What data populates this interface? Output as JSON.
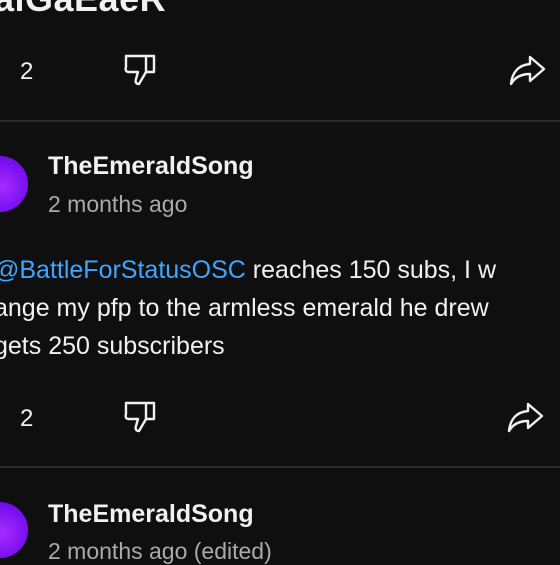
{
  "top_comment": {
    "text_fragment": "alGaEaeR",
    "likes": "2"
  },
  "comments": [
    {
      "username": "TheEmeraldSong",
      "timestamp": "2 months ago",
      "mention": "@BattleForStatusOSC",
      "text_line1_rest": " reaches 150 subs, I w",
      "text_line2": "ange my pfp to the armless emerald he drew",
      "text_line3": "gets 250 subscribers",
      "likes": "2"
    },
    {
      "username": "TheEmeraldSong",
      "timestamp": "2 months ago (edited)"
    }
  ],
  "colors": {
    "background": "#0f0f0f",
    "text": "#f1f1f1",
    "secondary_text": "#aaaaaa",
    "mention": "#3ea6ff",
    "avatar": "#7b10f2"
  },
  "icons": [
    "like-icon",
    "dislike-icon",
    "share-icon"
  ]
}
